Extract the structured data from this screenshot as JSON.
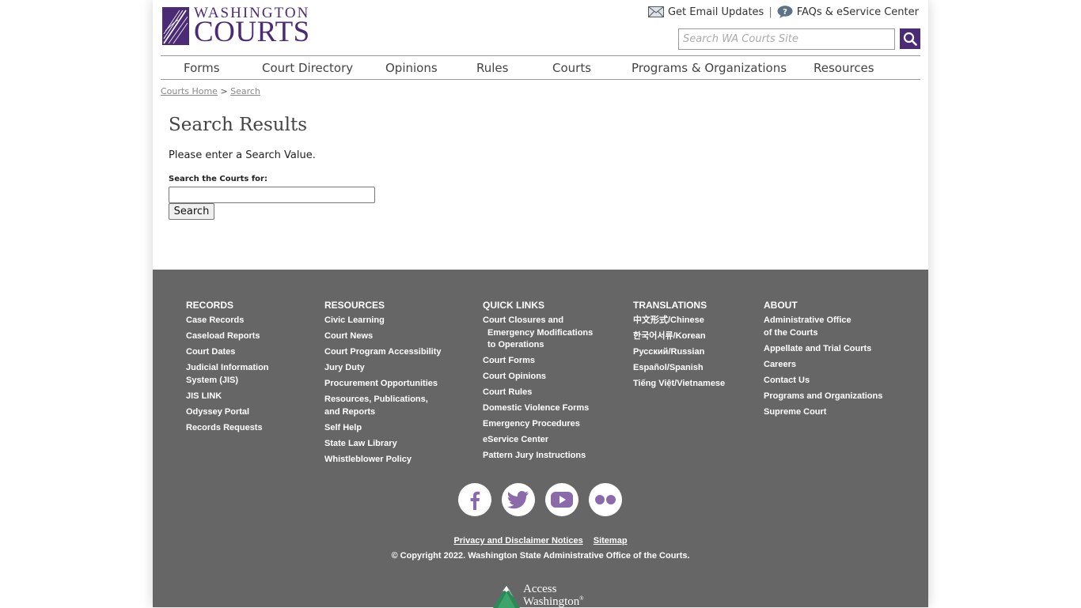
{
  "header": {
    "logo_top": "WASHINGTON",
    "logo_bottom": "COURTS",
    "email_link": "Get Email Updates",
    "separator": "|",
    "faq_link": "FAQs & eService Center",
    "search_placeholder": "Search WA Courts Site"
  },
  "nav": [
    {
      "label": "Forms"
    },
    {
      "label": "Court Directory"
    },
    {
      "label": "Opinions"
    },
    {
      "label": "Rules"
    },
    {
      "label": "Courts"
    },
    {
      "label": "Programs & Organizations"
    },
    {
      "label": "Resources"
    }
  ],
  "breadcrumb": {
    "home": "Courts Home",
    "separator": ">",
    "current": "Search"
  },
  "main": {
    "title": "Search Results",
    "message": "Please enter a Search Value.",
    "field_label": "Search the Courts for:",
    "button_label": "Search"
  },
  "footer": {
    "records": {
      "heading": "RECORDS",
      "links": [
        "Case Records",
        "Caseload Reports",
        "Court Dates",
        "Judicial Information",
        "System (JIS)",
        "JIS LINK",
        "Odyssey Portal",
        "Records Requests"
      ]
    },
    "resources": {
      "heading": "RESOURCES",
      "links": [
        "Civic Learning",
        "Court News",
        "Court Program Accessibility",
        "Jury Duty",
        "Procurement Opportunities",
        "Resources, Publications,",
        "and Reports",
        "Self Help",
        "State Law Library",
        "Whistleblower Policy"
      ]
    },
    "quick_links": {
      "heading": "QUICK LINKS",
      "links": [
        "Court Closures and",
        "Emergency Modifications",
        "to Operations",
        "Court Forms",
        "Court Opinions",
        "Court Rules",
        "Domestic Violence Forms",
        "Emergency Procedures",
        "eService Center",
        "Pattern Jury Instructions"
      ]
    },
    "translations": {
      "heading": "TRANSLATIONS",
      "links": [
        "中文形式/Chinese",
        "한국어서류/Korean",
        "Русский/Russian",
        "Español/Spanish",
        "Tiếng Việt/Vietnamese"
      ]
    },
    "about": {
      "heading": "ABOUT",
      "links": [
        "Administrative Office",
        "of the Courts",
        "Appellate and Trial Courts",
        "Careers",
        "Contact Us",
        "Programs and Organizations",
        "Supreme Court"
      ]
    },
    "social": [
      "facebook-icon",
      "twitter-icon",
      "youtube-icon",
      "flickr-icon"
    ],
    "privacy": "Privacy and Disclaimer Notices",
    "sitemap": "Sitemap",
    "copyright": "© Copyright 2022. Washington State Administrative Office of the Courts.",
    "access_top": "Access",
    "access_bottom": "Washington",
    "access_mark": "®"
  },
  "colors": {
    "brand_purple": "#4b2a76",
    "footer_bg": "#666666",
    "social_purple": "#8a6aa8"
  }
}
